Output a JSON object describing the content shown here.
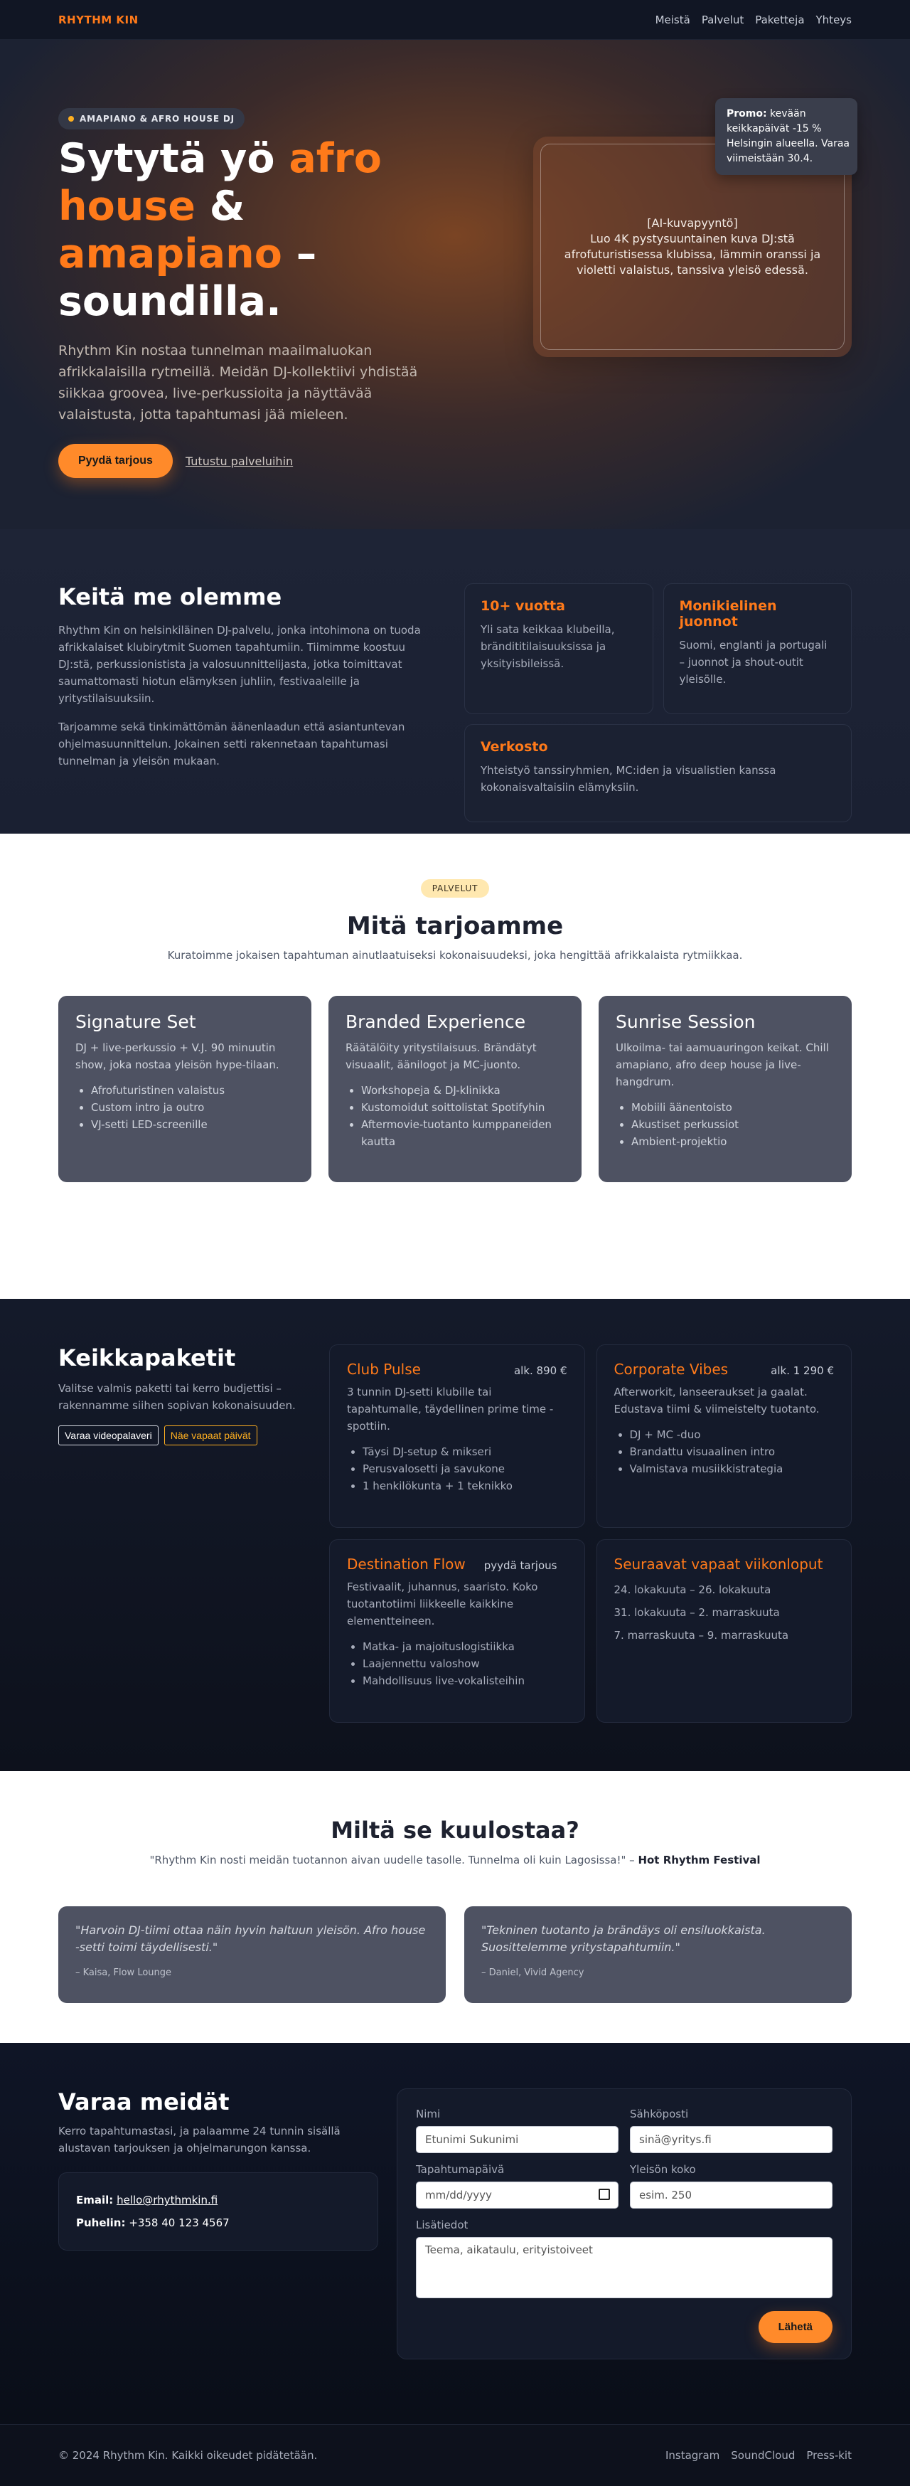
{
  "header": {
    "brand": "RHYTHM KIN",
    "nav": [
      "Meistä",
      "Palvelut",
      "Paketteja",
      "Yhteys"
    ]
  },
  "hero": {
    "badge": "AMAPIANO & AFRO HOUSE DJ",
    "title_1": "Sytytä yö ",
    "title_acc_1": "afro house",
    "title_2": " & ",
    "title_acc_2": "amapiano",
    "title_3": " – soundilla.",
    "lead": "Rhythm Kin nostaa tunnelman maailmaluokan afrikkalaisilla rytmeillä. Meidän DJ-kollektiivi yhdistää siikkaa groovea, live-perkussioita ja näyttävää valaistusta, jotta tapahtumasi jää mieleen.",
    "cta_primary": "Pyydä tarjous",
    "cta_secondary": "Tutustu palveluihin",
    "media_title": "[AI-kuvapyyntö]",
    "media_desc": "Luo 4K pystysuuntainen kuva DJ:stä afrofuturistisessa klubissa, lämmin oranssi ja violetti valaistus, tanssiva yleisö edessä.",
    "promo_label": "Promo:",
    "promo_text_1": " kevään",
    "promo_text_2": "keikkapäivät -15 %",
    "promo_text_3": "Helsingin alueella. Varaa",
    "promo_text_4": "viimeistään 30.4."
  },
  "about": {
    "title": "Keitä me olemme",
    "p1": "Rhythm Kin on helsinkiläinen DJ-palvelu, jonka intohimona on tuoda afrikkalaiset klubirytmit Suomen tapahtumiin. Tiimimme koostuu DJ:stä, perkussionistista ja valosuunnittelijasta, jotka toimittavat saumattomasti hiotun elämyksen juhliin, festivaaleille ja yritystilaisuuksiin.",
    "p2": "Tarjoamme sekä tinkimättömän äänenlaadun että asiantuntevan ohjelmasuunnittelun. Jokainen setti rakennetaan tapahtumasi tunnelman ja yleisön mukaan.",
    "cards": [
      {
        "title": "10+ vuotta",
        "text": "Yli sata keikkaa klubeilla, brändititilaisuuksissa ja yksityisbileissä."
      },
      {
        "title": "Monikielinen juonnot",
        "text": "Suomi, englanti ja portugali – juonnot ja shout-outit yleisölle."
      },
      {
        "title": "Verkosto",
        "text": "Yhteistyö tanssiryhmien, MC:iden ja visualistien kanssa kokonaisvaltaisiin elämyksiin."
      }
    ]
  },
  "services": {
    "pill": "PALVELUT",
    "title": "Mitä tarjoamme",
    "subtitle": "Kuratoimme jokaisen tapahtuman ainutlaatuiseksi kokonaisuudeksi, joka hengittää afrikkalaista rytmiikkaa.",
    "items": [
      {
        "title": "Signature Set",
        "text": "DJ + live-perkussio + V.J. 90 minuutin show, joka nostaa yleisön hype-tilaan.",
        "bullets": [
          "Afrofuturistinen valaistus",
          "Custom intro ja outro",
          "VJ-setti LED-screenille"
        ]
      },
      {
        "title": "Branded Experience",
        "text": "Räätälöity yritystilaisuus. Brändätyt visuaalit, äänilogot ja MC-juonto.",
        "bullets": [
          "Workshopeja & DJ-klinikka",
          "Kustomoidut soittolistat Spotifyhin",
          "Aftermovie-tuotanto kumppaneiden kautta"
        ]
      },
      {
        "title": "Sunrise Session",
        "text": "Ulkoilma- tai aamuauringon keikat. Chill amapiano, afro deep house ja live-hangdrum.",
        "bullets": [
          "Mobiili äänentoisto",
          "Akustiset perkussiot",
          "Ambient-projektio"
        ]
      }
    ]
  },
  "packages": {
    "title": "Keikkapaketit",
    "text": "Valitse valmis paketti tai kerro budjettisi – rakennamme siihen sopivan kokonaisuuden.",
    "btn_video": "Varaa videopalaveri",
    "btn_dates": "Näe vapaat päivät",
    "items": [
      {
        "title": "Club Pulse",
        "price": "alk. 890 €",
        "text": "3 tunnin DJ-setti klubille tai tapahtumalle, täydellinen prime time -spottiin.",
        "bullets": [
          "Täysi DJ-setup & mikseri",
          "Perusvalosetti ja savukone",
          "1 henkilökunta + 1 teknikko"
        ]
      },
      {
        "title": "Corporate Vibes",
        "price": "alk. 1 290 €",
        "text": "Afterworkit, lanseeraukset ja gaalat. Edustava tiimi & viimeistelty tuotanto.",
        "bullets": [
          "DJ + MC -duo",
          "Brandattu visuaalinen intro",
          "Valmistava musiikkistrategia"
        ]
      },
      {
        "title": "Destination Flow",
        "price": "pyydä tarjous",
        "text": "Festivaalit, juhannus, saaristo. Koko tuotantotiimi liikkeelle kaikkine elementteineen.",
        "bullets": [
          "Matka- ja majoituslogistiikka",
          "Laajennettu valoshow",
          "Mahdollisuus live-vokalisteihin"
        ]
      }
    ],
    "dates_title": "Seuraavat vapaat viikonloput",
    "dates": [
      "24. lokakuuta – 26. lokakuuta",
      "31. lokakuuta – 2. marraskuuta",
      "7. marraskuuta – 9. marraskuuta"
    ]
  },
  "testimonials": {
    "title": "Miltä se kuulostaa?",
    "quote": "\"Rhythm Kin nosti meidän tuotannon aivan uudelle tasolle. Tunnelma oli kuin Lagosissa!\" – ",
    "quote_source": "Hot Rhythm Festival",
    "items": [
      {
        "text": "\"Harvoin DJ-tiimi ottaa näin hyvin haltuun yleisön. Afro house -setti toimi täydellisesti.\"",
        "who": "– Kaisa, Flow Lounge"
      },
      {
        "text": "\"Tekninen tuotanto ja brändäys oli ensiluokkaista. Suosittelemme yritystapahtumiin.\"",
        "who": "– Daniel, Vivid Agency"
      }
    ]
  },
  "contact": {
    "title": "Varaa meidät",
    "text": "Kerro tapahtumastasi, ja palaamme 24 tunnin sisällä alustavan tarjouksen ja ohjelmarungon kanssa.",
    "email_label": "Email:",
    "email": "hello@rhythmkin.fi",
    "phone_label": "Puhelin:",
    "phone": "+358 40 123 4567",
    "form": {
      "name_label": "Nimi",
      "name_placeholder": "Etunimi Sukunimi",
      "email_label": "Sähköposti",
      "email_placeholder": "sinä@yritys.fi",
      "date_label": "Tapahtumapäivä",
      "date_placeholder": "mm/dd/yyyy",
      "audience_label": "Yleisön koko",
      "audience_placeholder": "esim. 250",
      "details_label": "Lisätiedot",
      "details_placeholder": "Teema, aikataulu, erityistoiveet",
      "submit": "Lähetä"
    }
  },
  "footer": {
    "copy": "© 2024 Rhythm Kin. Kaikki oikeudet pidätetään.",
    "links": [
      "Instagram",
      "SoundCloud",
      "Press-kit"
    ]
  },
  "colors": {
    "accent": "#ff7a1a",
    "dark": "#0f1320",
    "card": "#4e5262"
  }
}
